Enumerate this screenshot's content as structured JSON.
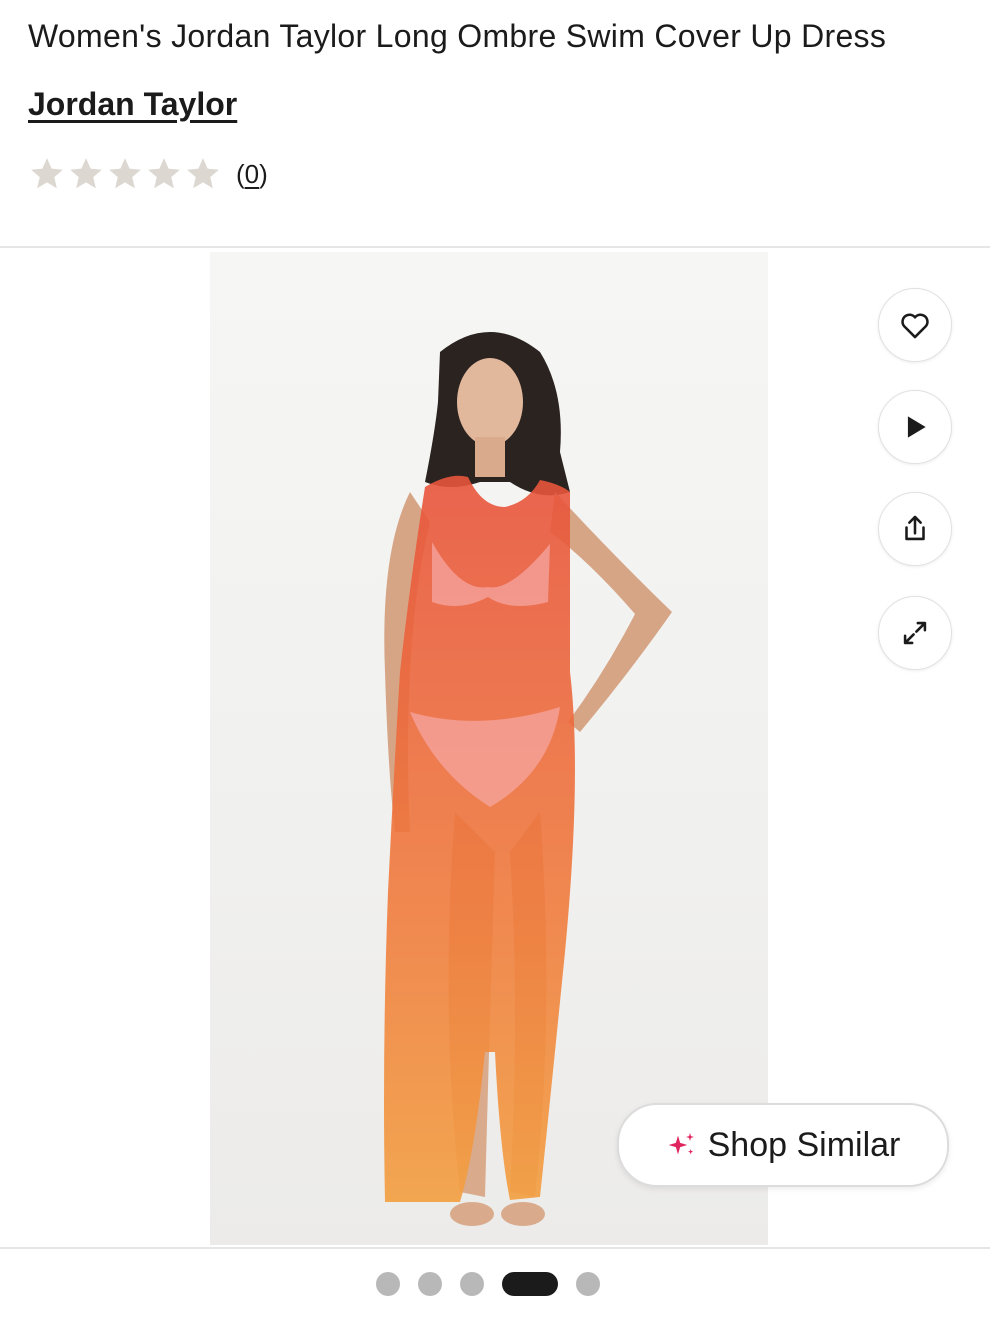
{
  "product": {
    "title": "Women's Jordan Taylor Long Ombre Swim Cover Up Dress",
    "brand": "Jordan Taylor",
    "rating": {
      "stars": 0,
      "max_stars": 5,
      "review_count": "0"
    }
  },
  "gallery": {
    "image_description": "Model wearing long sheer ombre mesh swim cover up dress",
    "dress_gradient": [
      "#e8543c",
      "#f07a3a",
      "#f3a043"
    ],
    "slides_total": 5,
    "active_slide": 4,
    "actions": [
      {
        "name": "favorite",
        "icon": "heart-icon"
      },
      {
        "name": "play-video",
        "icon": "play-icon"
      },
      {
        "name": "share",
        "icon": "share-icon"
      },
      {
        "name": "expand",
        "icon": "expand-icon"
      }
    ],
    "shop_similar": {
      "label": "Shop Similar",
      "icon": "sparkle-icon",
      "icon_color": "#e0245e"
    }
  },
  "colors": {
    "star_empty": "#dcd8d1",
    "text": "#1b1b1b",
    "dot_inactive": "#b8b8b8",
    "dot_active": "#1b1b1b"
  }
}
